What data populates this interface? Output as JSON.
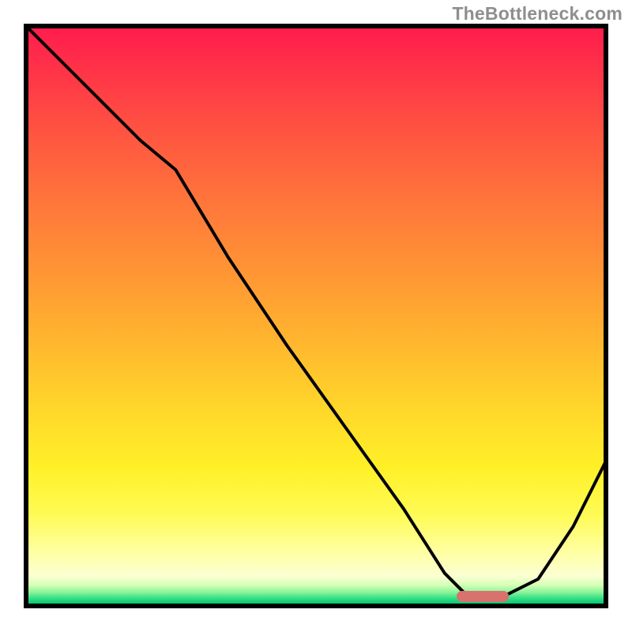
{
  "watermark": {
    "text": "TheBottleneck.com"
  },
  "chart_data": {
    "type": "line",
    "title": "",
    "xlabel": "",
    "ylabel": "",
    "xlim": [
      0,
      100
    ],
    "ylim": [
      0,
      100
    ],
    "grid": false,
    "legend": false,
    "background_gradient": {
      "orientation": "vertical",
      "stops": [
        {
          "pos": 0.0,
          "color": "#ff1a4d"
        },
        {
          "pos": 0.2,
          "color": "#ff5840"
        },
        {
          "pos": 0.44,
          "color": "#ff9933"
        },
        {
          "pos": 0.66,
          "color": "#ffd72a"
        },
        {
          "pos": 0.84,
          "color": "#fffb55"
        },
        {
          "pos": 0.94,
          "color": "#fbffd2"
        },
        {
          "pos": 0.97,
          "color": "#8df59a"
        },
        {
          "pos": 1.0,
          "color": "#0aad64"
        }
      ]
    },
    "series": [
      {
        "name": "bottleneck-curve",
        "color": "#000000",
        "x": [
          0,
          10,
          20,
          26,
          35,
          45,
          55,
          65,
          72,
          76,
          82,
          88,
          94,
          100
        ],
        "y": [
          100,
          90,
          80,
          75,
          60,
          45,
          31,
          17,
          6,
          2,
          2,
          5,
          14,
          26
        ]
      }
    ],
    "annotations": [
      {
        "name": "optimal-range-marker",
        "type": "bar-segment",
        "color": "#d9716e",
        "x_start": 74,
        "x_end": 83,
        "y": 2
      }
    ]
  }
}
